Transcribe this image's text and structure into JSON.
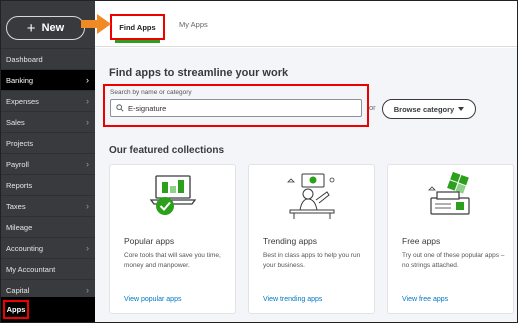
{
  "sidebar": {
    "new_label": "New",
    "items": [
      {
        "label": "Dashboard",
        "chevron": false,
        "active": false
      },
      {
        "label": "Banking",
        "chevron": true,
        "active": true
      },
      {
        "label": "Expenses",
        "chevron": true,
        "active": false
      },
      {
        "label": "Sales",
        "chevron": true,
        "active": false
      },
      {
        "label": "Projects",
        "chevron": false,
        "active": false
      },
      {
        "label": "Payroll",
        "chevron": true,
        "active": false
      },
      {
        "label": "Reports",
        "chevron": false,
        "active": false
      },
      {
        "label": "Taxes",
        "chevron": true,
        "active": false
      },
      {
        "label": "Mileage",
        "chevron": false,
        "active": false
      },
      {
        "label": "Accounting",
        "chevron": true,
        "active": false
      },
      {
        "label": "My Accountant",
        "chevron": false,
        "active": false
      },
      {
        "label": "Capital",
        "chevron": true,
        "active": false
      }
    ],
    "apps_label": "Apps"
  },
  "tabs": {
    "find_apps": "Find Apps",
    "my_apps": "My Apps"
  },
  "main": {
    "title": "Find apps to streamline your work",
    "search_label": "Search by name or category",
    "search_value": "E-signature",
    "or_text": "or",
    "browse_label": "Browse category",
    "featured_title": "Our featured collections"
  },
  "cards": [
    {
      "title": "Popular apps",
      "desc": "Core tools that will save you time, money and manpower.",
      "link": "View popular apps"
    },
    {
      "title": "Trending apps",
      "desc": "Best in class apps to help you run your business.",
      "link": "View trending apps"
    },
    {
      "title": "Free apps",
      "desc": "Try out one of these popular apps – no strings attached.",
      "link": "View free apps"
    }
  ],
  "colors": {
    "sidebar_bg": "#393a3d",
    "accent_green": "#2ca01c",
    "highlight_red": "#e00000",
    "link_blue": "#0077c5",
    "arrow_orange": "#f08a24"
  }
}
